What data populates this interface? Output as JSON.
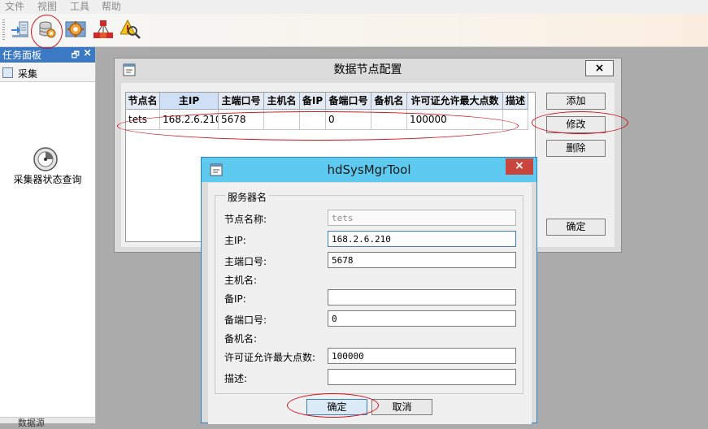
{
  "menubar": {
    "items": [
      "文件",
      "视图",
      "工具",
      "帮助"
    ]
  },
  "toolbar": {
    "buttons": [
      "export-icon",
      "database-config-icon",
      "gear-icon",
      "network-icon",
      "alert-search-icon"
    ]
  },
  "left_panel": {
    "title": "任务面板",
    "pin_glyph": "🗗",
    "close_glyph": "×",
    "section": "采集",
    "item": "采集器状态查询",
    "bottom_tab": "数据源"
  },
  "config_window": {
    "title": "数据节点配置",
    "close_glyph": "×",
    "columns": [
      "节点名",
      "主IP",
      "主端口号",
      "主机名",
      "备IP",
      "备端口号",
      "备机名",
      "许可证允许最大点数",
      "描述"
    ],
    "rows": [
      [
        "tets",
        "168.2.6.210",
        "5678",
        "",
        "",
        "0",
        "",
        "100000",
        ""
      ]
    ],
    "buttons": {
      "add": "添加",
      "modify": "修改",
      "delete": "删除",
      "ok": "确定"
    }
  },
  "dialog": {
    "title": "hdSysMgrTool",
    "close_glyph": "×",
    "group_label": "服务器名",
    "fields": {
      "node_name": {
        "label": "节点名称:",
        "value": "tets"
      },
      "main_ip": {
        "label": "主IP:",
        "value": "168.2.6.210"
      },
      "main_port": {
        "label": "主端口号:",
        "value": "5678"
      },
      "main_host": {
        "label": "主机名:"
      },
      "backup_ip": {
        "label": "备IP:",
        "value": ""
      },
      "backup_port": {
        "label": "备端口号:",
        "value": "0"
      },
      "backup_host": {
        "label": "备机名:"
      },
      "license_max": {
        "label": "许可证允许最大点数:",
        "value": "100000"
      },
      "description": {
        "label": "描述:",
        "value": ""
      }
    },
    "buttons": {
      "ok": "确定",
      "cancel": "取消"
    }
  },
  "colors": {
    "panel_header": "#3c79c4",
    "dialog_titlebar": "#5fcaf0",
    "close_button": "#c8463d",
    "annotation_red": "#d0141b"
  }
}
